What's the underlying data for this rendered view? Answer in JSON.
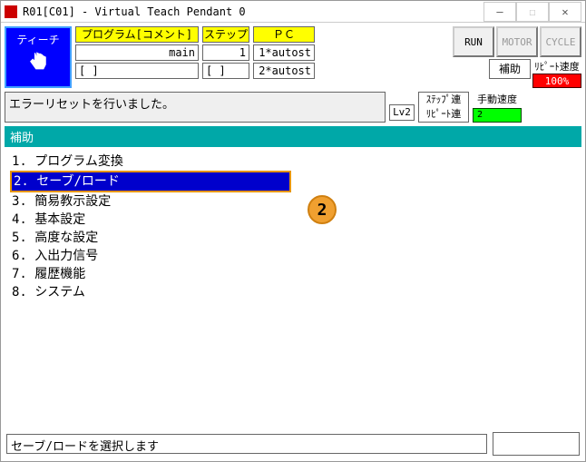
{
  "window": {
    "title": "R01[C01] - Virtual Teach Pendant 0"
  },
  "titlebar_controls": {
    "minimize": "—",
    "maximize": "☐",
    "close": "✕"
  },
  "teach": {
    "label": "ティーチ",
    "icon": "☝"
  },
  "program": {
    "header": "プログラム[コメント]",
    "line1": "main",
    "line2": "[                ]"
  },
  "step": {
    "header": "ステップ",
    "line1": "1",
    "line2": "[    ]"
  },
  "pc": {
    "header": "ＰＣ",
    "line1": "1*autost",
    "line2": "2*autost"
  },
  "buttons": {
    "run": "RUN",
    "motor": "MOTOR",
    "cycle": "CYCLE",
    "aux": "補助"
  },
  "speed": {
    "repeat_label": "ﾘﾋﾟｰﾄ速度",
    "repeat_value": "100%",
    "manual_label": "手動速度",
    "manual_value": "2"
  },
  "message": {
    "text": "エラーリセットを行いました。",
    "level": "Lv2"
  },
  "step_link": {
    "line1": "ｽﾃｯﾌﾟ連",
    "line2": "ﾘﾋﾟｰﾄ連"
  },
  "section": {
    "title": "補助"
  },
  "menu": [
    {
      "num": "1.",
      "label": "プログラム変換"
    },
    {
      "num": "2.",
      "label": "セーブ/ロード"
    },
    {
      "num": "3.",
      "label": "簡易教示設定"
    },
    {
      "num": "4.",
      "label": "基本設定"
    },
    {
      "num": "5.",
      "label": "高度な設定"
    },
    {
      "num": "6.",
      "label": "入出力信号"
    },
    {
      "num": "7.",
      "label": "履歴機能"
    },
    {
      "num": "8.",
      "label": "システム"
    }
  ],
  "callout": {
    "label": "2"
  },
  "footer": {
    "hint": "セーブ/ロードを選択します"
  }
}
